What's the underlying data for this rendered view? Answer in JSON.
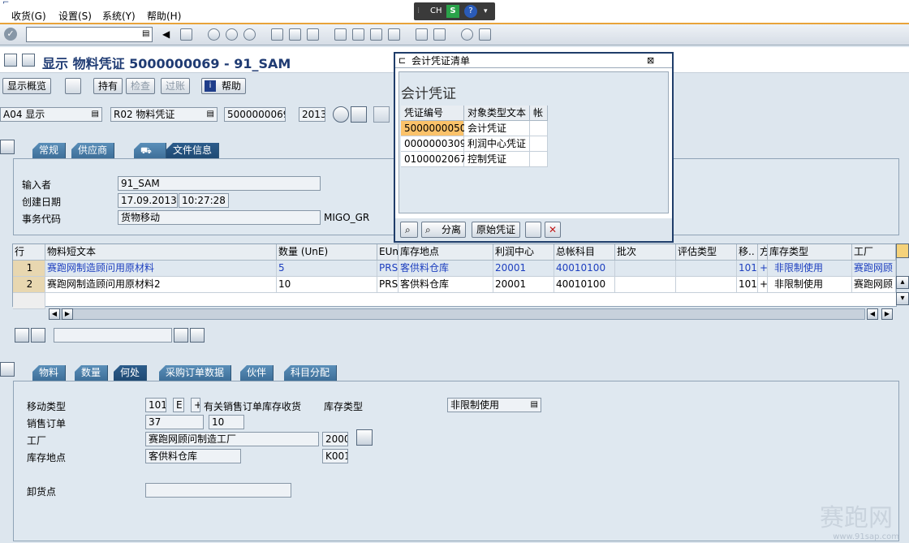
{
  "menu": {
    "items": [
      "收货(G)",
      "设置(S)",
      "系统(Y)",
      "帮助(H)"
    ]
  },
  "ime": {
    "lang": "CH",
    "s": "S",
    "help": "?"
  },
  "title": "显示 物料凭证 5000000069 - 91_SAM",
  "apptb": {
    "overview": "显示概览",
    "hold": "持有",
    "check": "检查",
    "post": "过账",
    "help": "帮助"
  },
  "header": {
    "action": "A04 显示",
    "ref": "R02 物料凭证",
    "doc": "5000000069",
    "year": "2013"
  },
  "tabs1": [
    "常规",
    "供应商",
    "",
    "文件信息"
  ],
  "docinfo": {
    "entered_label": "输入者",
    "entered": "91_SAM",
    "date_label": "创建日期",
    "date": "17.09.2013",
    "time": "10:27:28",
    "tcode_label": "事务代码",
    "tcode": "货物移动",
    "tcode_val": "MIGO_GR"
  },
  "grid": {
    "headers": [
      "行",
      "物料短文本",
      "数量 (UnE)",
      "EUn",
      "库存地点",
      "利润中心",
      "总帐科目",
      "批次",
      "评估类型",
      "移..",
      "方",
      "库存类型",
      "工厂"
    ],
    "rows": [
      [
        "1",
        "赛跑网制造顾问用原材料",
        "5",
        "PRS",
        "客供料仓库",
        "20001",
        "40010100",
        "",
        "",
        "101",
        "+",
        "非限制使用",
        "赛跑网顾"
      ],
      [
        "2",
        "赛跑网制造顾问用原材料2",
        "10",
        "PRS",
        "客供料仓库",
        "20001",
        "40010100",
        "",
        "",
        "101",
        "+",
        "非限制使用",
        "赛跑网顾"
      ]
    ]
  },
  "tabs2": [
    "物料",
    "数量",
    "何处",
    "采购订单数据",
    "伙伴",
    "科目分配"
  ],
  "where": {
    "mvt_label": "移动类型",
    "mvt": "101",
    "e": "E",
    "plus": "+",
    "mvt_text": "有关销售订单库存收货",
    "stype_label": "库存类型",
    "stype": "非限制使用",
    "so_label": "销售订单",
    "so": "37",
    "so_item": "10",
    "plant_label": "工厂",
    "plant": "赛跑网顾问制造工厂",
    "plant_code": "2000",
    "sloc_label": "库存地点",
    "sloc": "客供料仓库",
    "sloc_code": "K001",
    "unload_label": "卸货点"
  },
  "popup": {
    "title": "会计凭证清单",
    "heading": "会计凭证",
    "headers": [
      "凭证编号",
      "对象类型文本",
      "帐"
    ],
    "rows": [
      [
        "5000000050",
        "会计凭证",
        ""
      ],
      [
        "0000000309",
        "利润中心凭证",
        ""
      ],
      [
        "0100002067",
        "控制凭证",
        ""
      ]
    ],
    "split": "分离",
    "orig": "原始凭证"
  },
  "watermark": "赛跑网",
  "watermark_url": "www.91sap.com"
}
